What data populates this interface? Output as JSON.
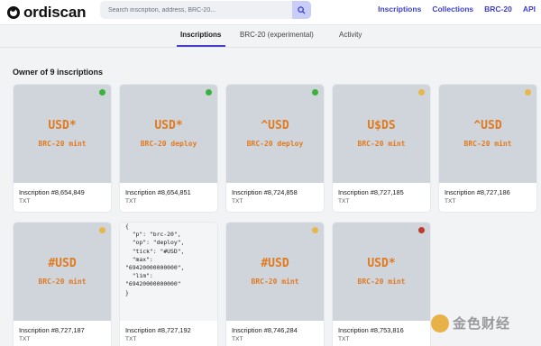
{
  "header": {
    "logo_text": "ordiscan",
    "search_placeholder": "Search inscription, address, BRC-20...",
    "nav": [
      "Inscriptions",
      "Collections",
      "BRC-20",
      "API"
    ]
  },
  "tabs": [
    "Inscriptions",
    "BRC-20 (experimental)",
    "Activity"
  ],
  "owner_text": "Owner of 9 inscriptions",
  "cards": [
    {
      "tick": "USD*",
      "op": "BRC-20 mint",
      "title": "Inscription #8,654,849",
      "type": "TXT",
      "status_color": "#3bb33b"
    },
    {
      "tick": "USD*",
      "op": "BRC-20 deploy",
      "title": "Inscription #8,654,851",
      "type": "TXT",
      "status_color": "#3bb33b"
    },
    {
      "tick": "^USD",
      "op": "BRC-20 deploy",
      "title": "Inscription #8,724,858",
      "type": "TXT",
      "status_color": "#3bb33b"
    },
    {
      "tick": "U$DS",
      "op": "BRC-20 mint",
      "title": "Inscription #8,727,185",
      "type": "TXT",
      "status_color": "#e6b84a"
    },
    {
      "tick": "^USD",
      "op": "BRC-20 mint",
      "title": "Inscription #8,727,186",
      "type": "TXT",
      "status_color": "#e6b84a"
    },
    {
      "tick": "#USD",
      "op": "BRC-20 mint",
      "title": "Inscription #8,727,187",
      "type": "TXT",
      "status_color": "#e6b84a"
    },
    {
      "json_lines": [
        "{",
        "  \"p\": \"brc-20\",",
        "  \"op\": \"deploy\",",
        "  \"tick\": \"#USD\",",
        "  \"max\":",
        "\"69420000000000\",",
        "  \"lim\":",
        "\"69420000000000\"",
        "}"
      ],
      "title": "Inscription #8,727,192",
      "type": "TXT"
    },
    {
      "tick": "#USD",
      "op": "BRC-20 mint",
      "title": "Inscription #8,746,284",
      "type": "TXT",
      "status_color": "#e6b84a"
    },
    {
      "tick": "USD*",
      "op": "BRC-20 mint",
      "title": "Inscription #8,753,816",
      "type": "TXT",
      "status_color": "#c0392b"
    }
  ],
  "watermark": {
    "text": "金色财经"
  },
  "colors": {
    "accent": "#3b3fd1",
    "tick": "#e07a1f"
  }
}
